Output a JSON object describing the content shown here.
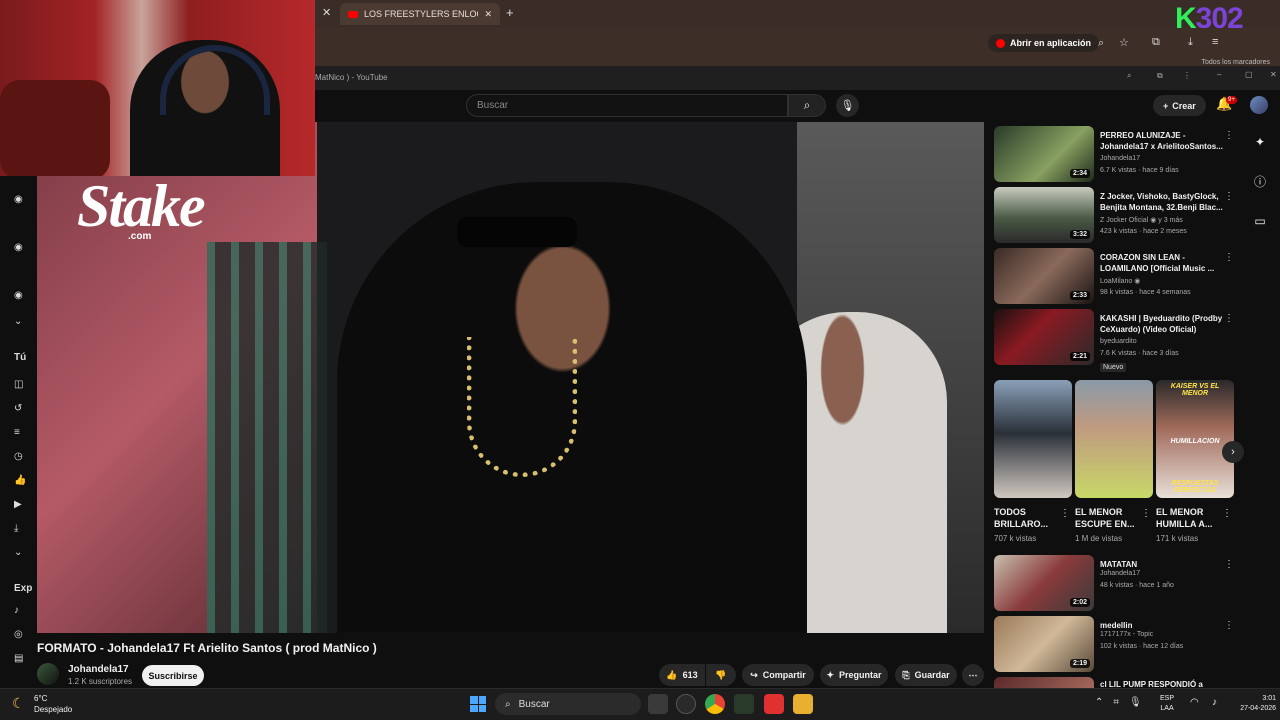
{
  "outer_browser": {
    "tab_title": "LOS FREESTYLERS ENLOQUECI",
    "open_in_app": "Abrir en aplicación",
    "bookmarks_text": "Todos los marcadores",
    "overlay_logo_k": "K",
    "overlay_logo_num": "302"
  },
  "inner_window": {
    "title": "MatNico ) - YouTube"
  },
  "header": {
    "search_placeholder": "Buscar",
    "create_label": "Crear",
    "notification_count": "9+"
  },
  "stream_overlay": {
    "sponsor": "Stake",
    "sponsor_suffix": ".com"
  },
  "sidebar": {
    "section_you": "Tú",
    "section_explore": "Exp"
  },
  "video": {
    "title": "FORMATO - Johandela17 Ft Arielito Santos ( prod MatNico )",
    "channel": "Johandela17",
    "subscribers": "1.2 K suscriptores",
    "subscribe": "Suscribirse",
    "likes": "613",
    "share": "Compartir",
    "ask": "Preguntar",
    "save": "Guardar"
  },
  "recommendations": [
    {
      "title": "PERREO ALUNIZAJE - Johandela17 x ArielitooSantos...",
      "channel": "Johandela17",
      "meta": "6.7 K vistas · hace 9 días",
      "duration": "2:34",
      "color": "#2d3a2a"
    },
    {
      "title": "Z Jocker, Vishoko, BastyGlock, Benjita Montana, 32.Benji Blac...",
      "channel": "Z Jocker Oficial",
      "meta": "423 k vistas · hace 2 meses",
      "duration": "3:32",
      "extra": "3 más",
      "color": "#4a5a44"
    },
    {
      "title": "CORAZON SIN LEAN - LOAMILANO [Official Music ...",
      "channel": "LoaMilano",
      "meta": "98 k vistas · hace 4 semanas",
      "duration": "2:33",
      "color": "#3a2a26"
    },
    {
      "title": "KAKASHI | Byeduardito (Prodby CeXuardo) (Video Oficial)",
      "channel": "byeduardito",
      "meta": "7.6 K vistas · hace 3 días",
      "duration": "2:21",
      "badge": "Nuevo",
      "color": "#3a1a1e"
    },
    {
      "title": "MATATAN",
      "channel": "Johandela17",
      "meta": "48 k vistas · hace 1 año",
      "duration": "2:02",
      "color": "#6a4a3a"
    },
    {
      "title": "medellin",
      "channel": "1717177x - Topic",
      "meta": "102 k vistas · hace 12 días",
      "duration": "2:19",
      "color": "#7a5a40"
    },
    {
      "title": "LIL PUMP RESPONDIÓ a",
      "prefix": "cl",
      "color": "#5a2a2a"
    }
  ],
  "shorts": [
    {
      "title": "TODOS BRILLARO...",
      "views": "707 k vistas",
      "caption": "",
      "color": "#6a7a8a"
    },
    {
      "title": "EL MENOR ESCUPE EN...",
      "views": "1 M de vistas",
      "caption": "",
      "color": "#8aa060"
    },
    {
      "title": "EL MENOR HUMILLA A...",
      "views": "171 k vistas",
      "caption": "KAISER VS EL MENOR",
      "caption2": "HUMILLACION",
      "caption3": "RESPUESTAS PERFECTAS",
      "color": "#a06a5a"
    }
  ],
  "taskbar": {
    "temp": "6°C",
    "weather": "Despejado",
    "search": "Buscar",
    "lang1": "ESP",
    "lang2": "LAA",
    "time": "3:01",
    "date": "27-04-2026"
  }
}
